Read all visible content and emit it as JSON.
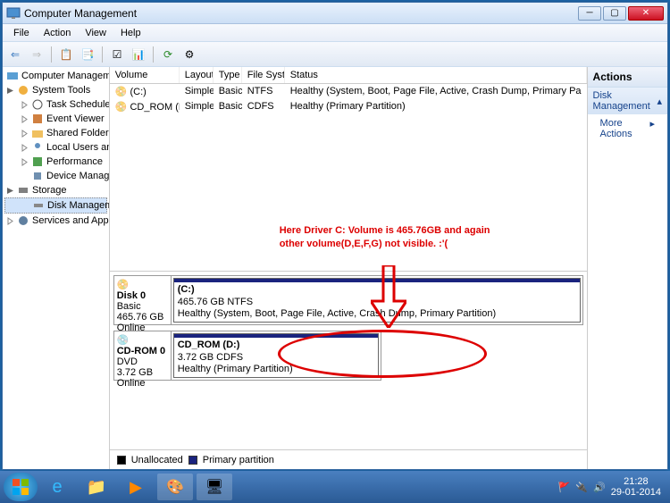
{
  "window": {
    "title": "Computer Management"
  },
  "menubar": [
    "File",
    "Action",
    "View",
    "Help"
  ],
  "tree": {
    "root": "Computer Management (Local",
    "systools": "System Tools",
    "ts": "Task Scheduler",
    "ev": "Event Viewer",
    "sf": "Shared Folders",
    "lug": "Local Users and Groups",
    "perf": "Performance",
    "dm": "Device Manager",
    "storage": "Storage",
    "disk": "Disk Management",
    "svc": "Services and Applications"
  },
  "cols": {
    "vol": "Volume",
    "lay": "Layout",
    "typ": "Type",
    "fs": "File System",
    "st": "Status"
  },
  "vols": [
    {
      "name": "(C:)",
      "lay": "Simple",
      "typ": "Basic",
      "fs": "NTFS",
      "st": "Healthy (System, Boot, Page File, Active, Crash Dump, Primary Pa"
    },
    {
      "name": "CD_ROM (D:)",
      "lay": "Simple",
      "typ": "Basic",
      "fs": "CDFS",
      "st": "Healthy (Primary Partition)"
    }
  ],
  "disks": [
    {
      "label": "Disk 0",
      "type": "Basic",
      "size": "465.76 GB",
      "status": "Online",
      "vol": {
        "name": "(C:)",
        "info": "465.76 GB NTFS",
        "st": "Healthy (System, Boot, Page File, Active, Crash Dump, Primary Partition)"
      }
    },
    {
      "label": "CD-ROM 0",
      "type": "DVD",
      "size": "3.72 GB",
      "status": "Online",
      "vol": {
        "name": "CD_ROM  (D:)",
        "info": "3.72 GB CDFS",
        "st": "Healthy (Primary Partition)"
      }
    }
  ],
  "legend": {
    "unalloc": "Unallocated",
    "primary": "Primary partition"
  },
  "actions": {
    "title": "Actions",
    "disk": "Disk Management",
    "more": "More Actions"
  },
  "annotation": {
    "line1": "Here Driver C: Volume is 465.76GB and again",
    "line2": "other volume(D,E,F,G) not visible. :'("
  },
  "tray": {
    "time": "21:28",
    "date": "29-01-2014"
  }
}
